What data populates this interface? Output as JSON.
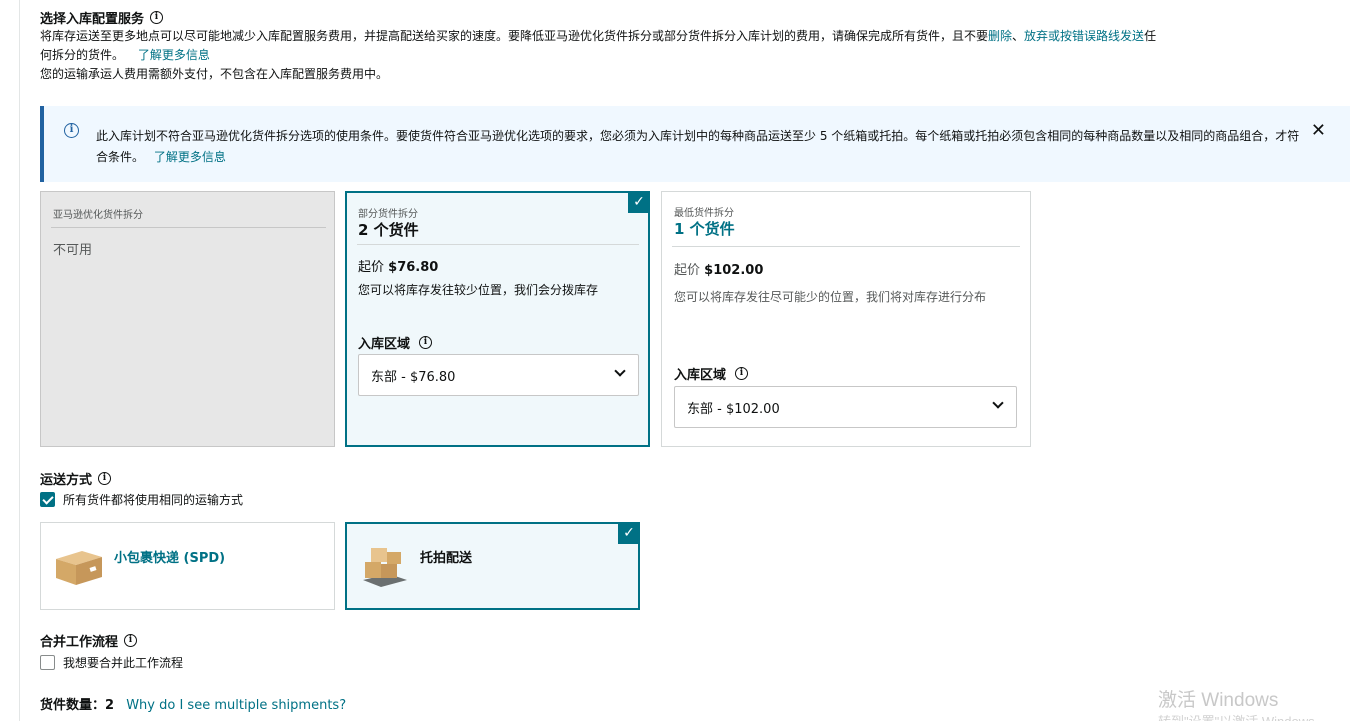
{
  "inbound_placement": {
    "title": "选择入库配置服务",
    "desc_line1_pre": "将库存运送至更多地点可以尽可能地减少入库配置服务费用，并提高配送给买家的速度。要降低亚马逊优化货件拆分或部分货件拆分入库计划的费用，请确保完成所有货件，且不要",
    "desc_link_delete": "删除",
    "desc_sep": "、",
    "desc_link_abandon": "放弃或按错误路线发送",
    "desc_line1_post": "任",
    "desc_line2": "何拆分的货件。",
    "learn_more": "了解更多信息",
    "desc_line3": "您的运输承运人费用需额外支付，不包含在入库配置服务费用中。"
  },
  "alert": {
    "text": "此入库计划不符合亚马逊优化货件拆分选项的使用条件。要使货件符合亚马逊优化选项的要求，您必须为入库计划中的每种商品运送至少 5 个纸箱或托拍。每个纸箱或托拍必须包含相同的每种商品数量以及相同的商品组合，才符合条件。",
    "learn_more": "了解更多信息",
    "close": "✕"
  },
  "options": [
    {
      "label": "亚马逊优化货件拆分",
      "status": "不可用"
    },
    {
      "label": "部分货件拆分",
      "title": "2 个货件",
      "price_prefix": "起价",
      "price": "$76.80",
      "desc": "您可以将库存发往较少位置，我们会分拨库存",
      "region_label": "入库区域",
      "region_value": "东部 - $76.80"
    },
    {
      "label": "最低货件拆分",
      "title": "1 个货件",
      "price_prefix": "起价",
      "price": "$102.00",
      "desc": "您可以将库存发往尽可能少的位置，我们将对库存进行分布",
      "region_label": "入库区域",
      "region_value": "东部 - $102.00"
    }
  ],
  "shipping": {
    "title": "运送方式",
    "same_method_label": "所有货件都将使用相同的运输方式",
    "same_method_checked": true,
    "methods": [
      {
        "label": "小包裹快递 (SPD)",
        "icon": "box-icon",
        "selected": false
      },
      {
        "label": "托拍配送",
        "icon": "pallet-icon",
        "selected": true
      }
    ]
  },
  "merge": {
    "title": "合并工作流程",
    "checkbox_label": "我想要合并此工作流程",
    "checked": false
  },
  "shipment_count": {
    "label": "货件数量：",
    "value": "2",
    "link": "Why do I see multiple shipments?"
  },
  "watermark": {
    "line1": "激活 Windows",
    "line2": "转到\"设置\"以激活 Windows。"
  },
  "colors": {
    "accent": "#007185",
    "alert_bg": "#f0f8ff",
    "alert_border": "#2162a1",
    "disabled_bg": "#e7e7e7"
  }
}
